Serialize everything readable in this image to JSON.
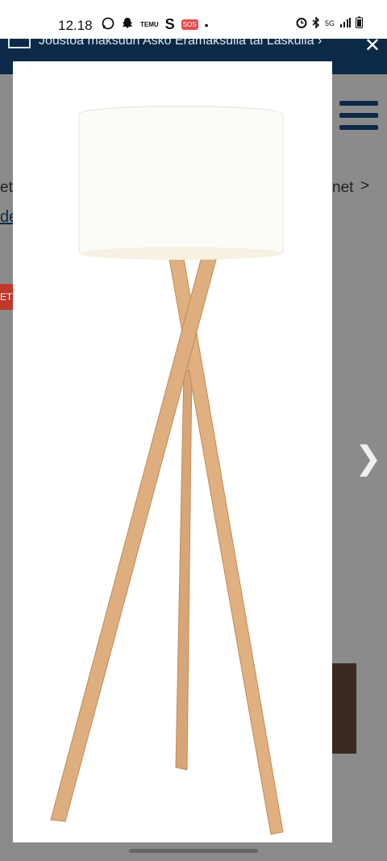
{
  "status_bar": {
    "time": "12.18",
    "left_icons": [
      "whatsapp-icon",
      "snapchat-icon",
      "temu-icon",
      "s-icon",
      "sos-icon",
      "dot-icon"
    ],
    "temu_label": "TEMU",
    "s_label": "S",
    "sos_label": "SOS",
    "network": "5G"
  },
  "banner": {
    "text": "Joustoa maksuun Asko Erämaksulla tai Laskulla ›"
  },
  "page": {
    "breadcrumb_left": "et",
    "breadcrumb_right": "net",
    "breadcrumb_arrow": ">",
    "link_fragment": "dé",
    "sale_badge": "ETU"
  },
  "colors": {
    "navy": "#0c2a48",
    "shade": "#fbfbf7",
    "wood": "#d9a877",
    "overlay": "#8b8b8b"
  }
}
